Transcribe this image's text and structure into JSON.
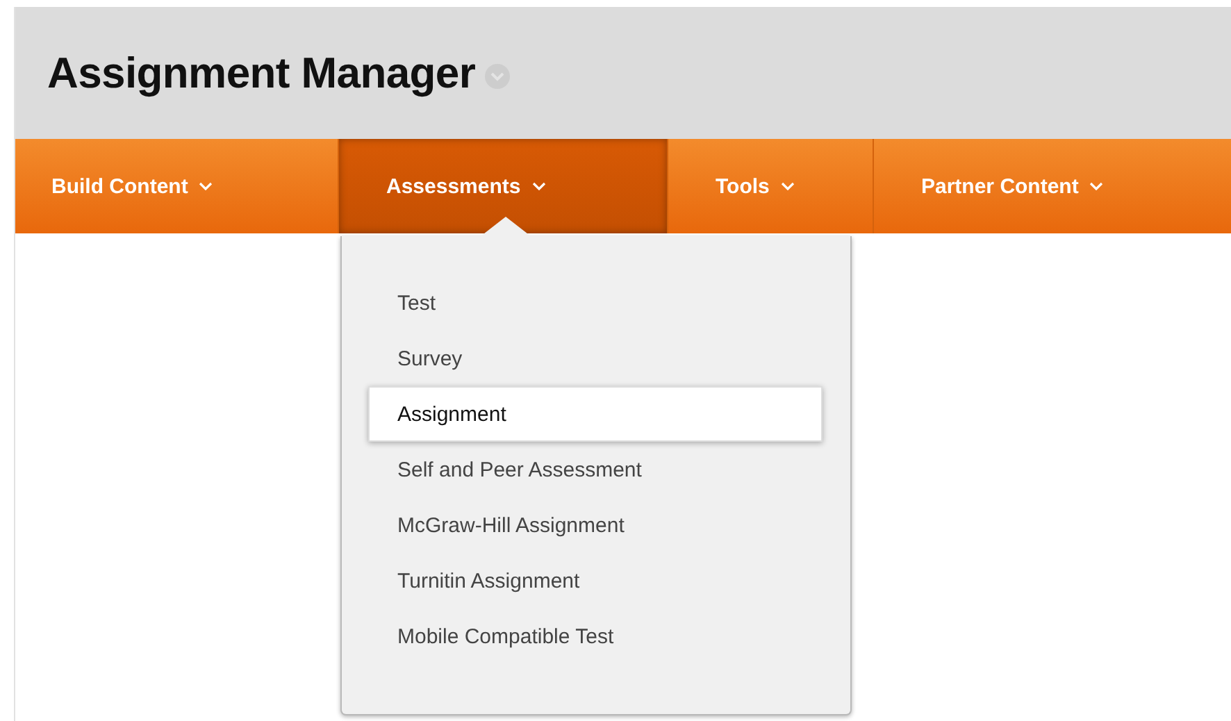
{
  "page": {
    "title": "Assignment Manager"
  },
  "nav": [
    {
      "label": "Build Content",
      "selected": false
    },
    {
      "label": "Assessments",
      "selected": true
    },
    {
      "label": "Tools",
      "selected": false
    },
    {
      "label": "Partner Content",
      "selected": false
    }
  ],
  "menu": {
    "items": [
      {
        "label": "Test",
        "selected": false
      },
      {
        "label": "Survey",
        "selected": false
      },
      {
        "label": "Assignment",
        "selected": true
      },
      {
        "label": "Self and Peer Assessment",
        "selected": false
      },
      {
        "label": "McGraw-Hill Assignment",
        "selected": false
      },
      {
        "label": "Turnitin Assignment",
        "selected": false
      },
      {
        "label": "Mobile Compatible Test",
        "selected": false
      }
    ]
  }
}
